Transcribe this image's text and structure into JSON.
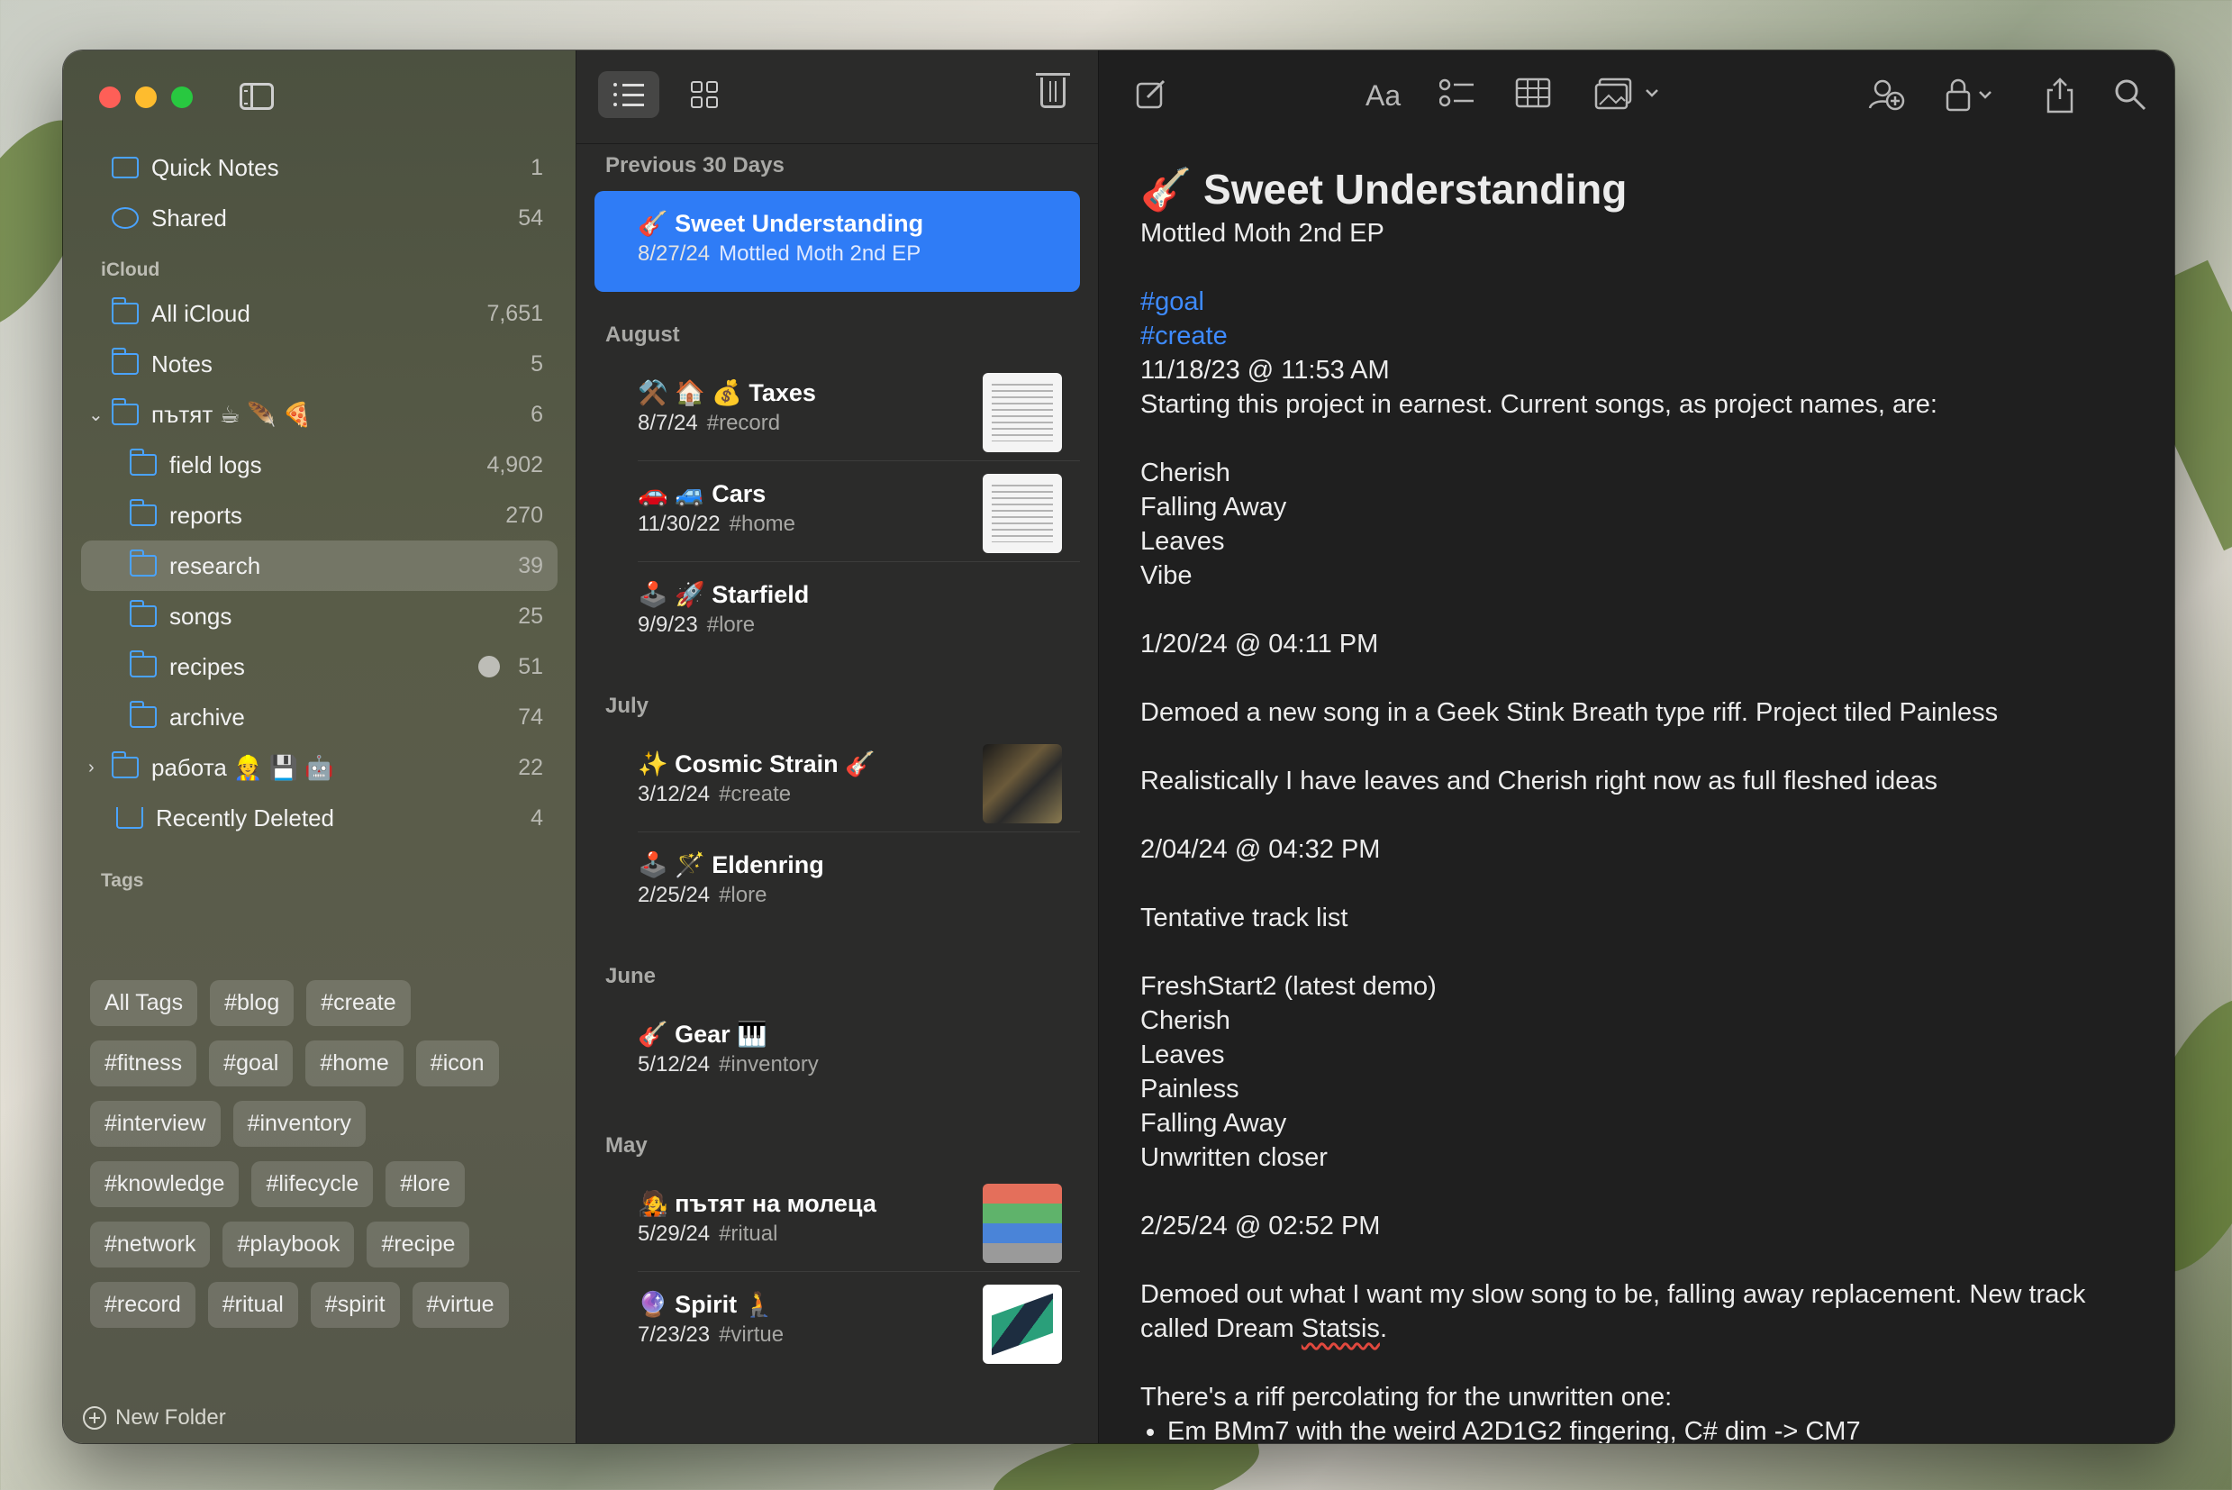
{
  "sidebar": {
    "items": [
      {
        "label": "Quick Notes",
        "count": "1"
      },
      {
        "label": "Shared",
        "count": "54"
      }
    ],
    "icloud_header": "iCloud",
    "folders": [
      {
        "label": "All iCloud",
        "count": "7,651"
      },
      {
        "label": "Notes",
        "count": "5"
      },
      {
        "label": "пътят ☕ 🪶 🍕",
        "count": "6"
      },
      {
        "label": "field logs",
        "count": "4,902"
      },
      {
        "label": "reports",
        "count": "270"
      },
      {
        "label": "research",
        "count": "39"
      },
      {
        "label": "songs",
        "count": "25"
      },
      {
        "label": "recipes",
        "count": "51"
      },
      {
        "label": "archive",
        "count": "74"
      },
      {
        "label": "работа 👷 💾 🤖",
        "count": "22"
      },
      {
        "label": "Recently Deleted",
        "count": "4"
      }
    ],
    "tags_header": "Tags",
    "tags": [
      "All Tags",
      "#blog",
      "#create",
      "#fitness",
      "#goal",
      "#home",
      "#icon",
      "#interview",
      "#inventory",
      "#knowledge",
      "#lifecycle",
      "#lore",
      "#network",
      "#playbook",
      "#recipe",
      "#record",
      "#ritual",
      "#spirit",
      "#virtue"
    ],
    "new_folder": "New Folder"
  },
  "notelist": {
    "groups": [
      {
        "header": "Previous 30 Days",
        "notes": [
          {
            "title": "🎸 Sweet Understanding",
            "date": "8/27/24",
            "snippet": "Mottled Moth 2nd EP"
          }
        ]
      },
      {
        "header": "August",
        "notes": [
          {
            "title": "⚒️ 🏠 💰 Taxes",
            "date": "8/7/24",
            "snippet": "#record"
          },
          {
            "title": "🚗 🚙 Cars",
            "date": "11/30/22",
            "snippet": "#home"
          },
          {
            "title": "🕹️ 🚀 Starfield",
            "date": "9/9/23",
            "snippet": "#lore"
          }
        ]
      },
      {
        "header": "July",
        "notes": [
          {
            "title": "✨ Cosmic Strain 🎸",
            "date": "3/12/24",
            "snippet": "#create"
          },
          {
            "title": "🕹️ 🪄 Eldenring",
            "date": "2/25/24",
            "snippet": "#lore"
          }
        ]
      },
      {
        "header": "June",
        "notes": [
          {
            "title": "🎸 Gear 🎹",
            "date": "5/12/24",
            "snippet": "#inventory"
          }
        ]
      },
      {
        "header": "May",
        "notes": [
          {
            "title": "🧑‍🎤 пътят на молеца",
            "date": "5/29/24",
            "snippet": "#ritual"
          },
          {
            "title": "🔮 Spirit 🧎",
            "date": "7/23/23",
            "snippet": "#virtue"
          }
        ]
      }
    ]
  },
  "editor": {
    "toolbar": {
      "format": "Aa"
    },
    "title": "🎸 Sweet Understanding",
    "subtitle": "Mottled Moth 2nd EP",
    "tag1": "#goal",
    "tag2": "#create",
    "lines": {
      "d1": "11/18/23 @ 11:53 AM",
      "p1": "Starting this project in earnest. Current songs, as project names, are:",
      "s1": "Cherish",
      "s2": "Falling Away",
      "s3": "Leaves",
      "s4": "Vibe",
      "d2": "1/20/24 @ 04:11 PM",
      "p2": "Demoed a new song in a Geek Stink Breath type riff. Project tiled Painless",
      "p3": "Realistically I have leaves and Cherish right now as full fleshed ideas",
      "d3": "2/04/24 @ 04:32 PM",
      "p4": "Tentative track list",
      "t1": "FreshStart2 (latest demo)",
      "t2": "Cherish",
      "t3": "Leaves",
      "t4": "Painless",
      "t5": "Falling Away",
      "t6": "Unwritten closer",
      "d4": "2/25/24 @ 02:52 PM",
      "p5a": "Demoed out what I want my slow song to be, falling away replacement. New track called Dream ",
      "p5b": "Statsis",
      "p5c": ".",
      "p6": "There's a riff percolating for the unwritten one:",
      "b1": "Em BMm7 with the weird A2D1G2 fingering, C# dim -> CM7"
    }
  }
}
